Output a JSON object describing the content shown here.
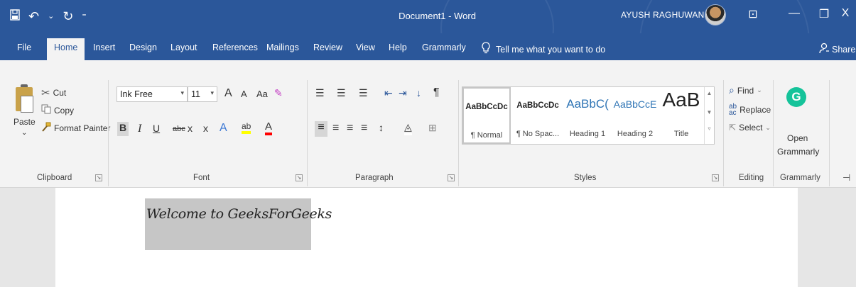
{
  "titlebar": {
    "qat": {
      "save_icon": "save-icon",
      "undo_glyph": "↶",
      "undo_dd": "⌄",
      "redo_glyph": "↻",
      "customize": "⁼"
    },
    "doc_title": "Document1 - Word",
    "user_name": "AYUSH RAGHUWANSHI",
    "ribbon_display": "⊡",
    "minimize": "—",
    "restore": "❐",
    "close": "X"
  },
  "tabs": {
    "file": "File",
    "home": "Home",
    "insert": "Insert",
    "design": "Design",
    "layout": "Layout",
    "references": "References",
    "mailings": "Mailings",
    "review": "Review",
    "view": "View",
    "help": "Help",
    "grammarly": "Grammarly",
    "tell_icon": "lightbulb-icon",
    "tell_me": "Tell me what you want to do",
    "share": "Share"
  },
  "clipboard": {
    "paste": "Paste",
    "paste_dd": "⌄",
    "cut": "Cut",
    "copy": "Copy",
    "format_painter": "Format Painter",
    "label": "Clipboard"
  },
  "font": {
    "font_name": "Ink Free",
    "font_size": "11",
    "grow": "A",
    "shrink": "A",
    "change_case": "Aa",
    "clear": "A",
    "bold": "B",
    "italic": "I",
    "underline": "U",
    "strike": "abc",
    "sub": "x",
    "sup": "x",
    "text_effects": "A",
    "highlight": "ab",
    "font_color": "A",
    "label": "Font"
  },
  "paragraph": {
    "bullets": "☰",
    "numbering": "☰",
    "multilevel": "☰",
    "decrease": "⇤",
    "increase": "⇥",
    "sort": "↓",
    "pilcrow": "¶",
    "left": "≡",
    "center": "≡",
    "right": "≡",
    "justify": "≡",
    "spacing": "↕",
    "shading": "◬",
    "borders": "⊞",
    "label": "Paragraph"
  },
  "styles": {
    "items": [
      {
        "preview": "AaBbCcDc",
        "name": "¶ Normal"
      },
      {
        "preview": "AaBbCcDc",
        "name": "¶ No Spac..."
      },
      {
        "preview": "AaBbC(",
        "name": "Heading 1"
      },
      {
        "preview": "AaBbCcE",
        "name": "Heading 2"
      },
      {
        "preview": "AaB",
        "name": "Title"
      }
    ],
    "label": "Styles"
  },
  "editing": {
    "find": "Find",
    "replace": "Replace",
    "select": "Select",
    "label": "Editing"
  },
  "grammarly_group": {
    "logo": "G",
    "open_line1": "Open",
    "open_line2": "Grammarly",
    "label": "Grammarly"
  },
  "document": {
    "text": "Welcome to GeeksForGeeks"
  },
  "colors": {
    "accent": "#2b579a",
    "grammarly": "#15c39a",
    "highlight": "#ffff00",
    "font_color_bar": "#ff0000"
  }
}
